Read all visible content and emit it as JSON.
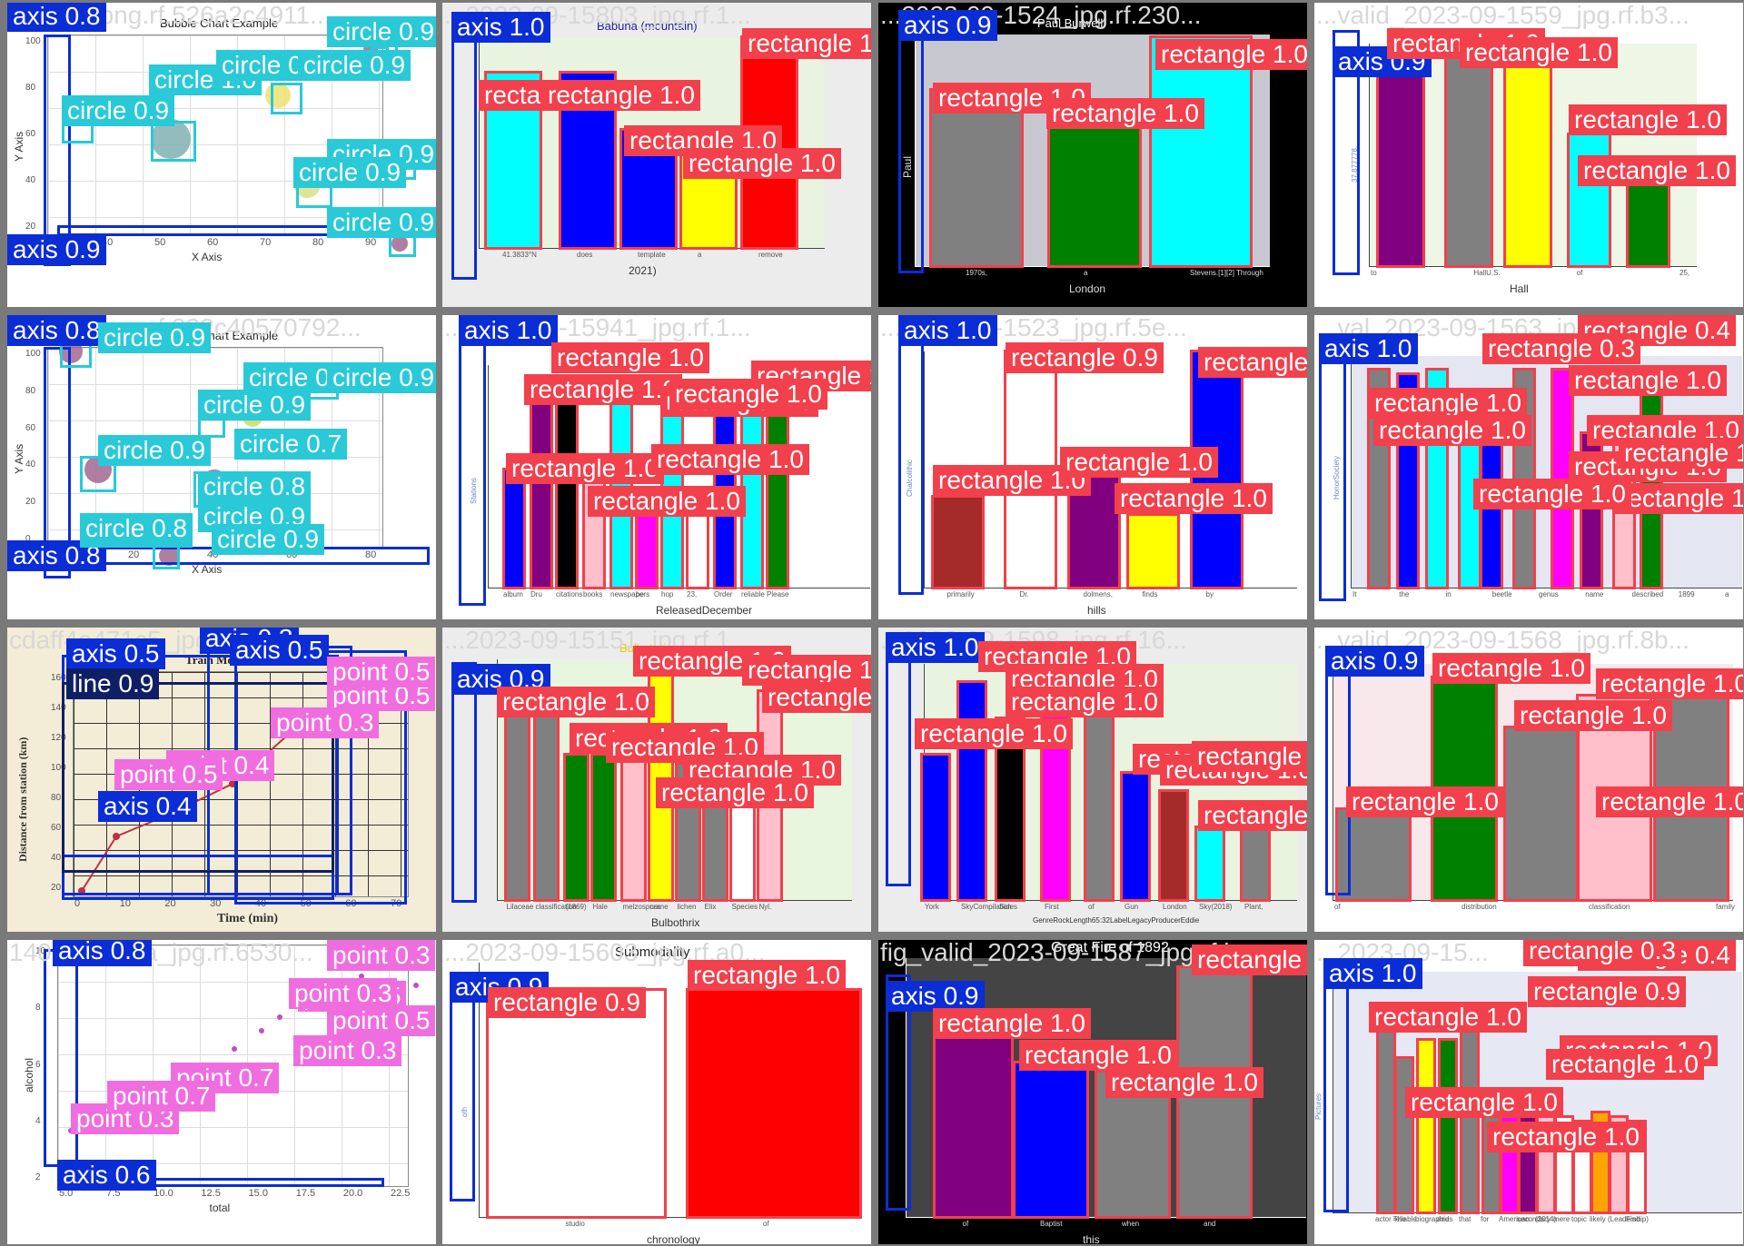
{
  "colors": {
    "axis": "#0b2dd6",
    "rectangle": "#f2404c",
    "circle": "#29c9d8",
    "point": "#f06ddf",
    "line": "#0f1f66"
  },
  "tiles": [
    {
      "filename": "bubble_png.rf.526a2c4911...",
      "title": "Bubble Chart Example",
      "xlabel": "X Axis",
      "ylabel": "Y Axis",
      "xticks": [
        "30",
        "40",
        "50",
        "60",
        "70",
        "80",
        "90"
      ],
      "yticks": [
        "100",
        "80",
        "60",
        "40",
        "20"
      ],
      "detections": [
        {
          "cls": "axis",
          "score": "0.8"
        },
        {
          "cls": "axis",
          "score": "0.9"
        },
        {
          "cls": "circle",
          "score": "0.9"
        },
        {
          "cls": "circle",
          "score": "0.9"
        },
        {
          "cls": "circle",
          "score": "1.0"
        },
        {
          "cls": "circle",
          "score": "0.9"
        },
        {
          "cls": "circle",
          "score": "0.9"
        },
        {
          "cls": "circle",
          "score": "0.9"
        },
        {
          "cls": "circle",
          "score": "0.9"
        },
        {
          "cls": "circle",
          "score": "0.9"
        }
      ]
    },
    {
      "filename": "...2023-09-15803_jpg.rf.1...",
      "title": "Babuna (mountain)",
      "xticks": [
        "41.3833°N",
        "does",
        "template",
        "a",
        "remove"
      ],
      "xlabel": "2021)",
      "detections": [
        {
          "cls": "axis",
          "score": "1.0"
        },
        {
          "cls": "rectangle",
          "score": "1.0"
        },
        {
          "cls": "rectangle",
          "score": "1.0"
        },
        {
          "cls": "rectangle",
          "score": "1.0"
        },
        {
          "cls": "rectangle",
          "score": "1.0"
        },
        {
          "cls": "rectangle",
          "score": "1.0"
        }
      ]
    },
    {
      "filename": "...2023-09-1524_jpg.rf.230...",
      "title": "Paul Burwell",
      "ylabel": "Paul",
      "xticks": [
        "1970s,",
        "a",
        "Stevens.[1][2] Through"
      ],
      "xlabel": "London",
      "detections": [
        {
          "cls": "axis",
          "score": "0.9"
        },
        {
          "cls": "rectangle",
          "score": "1.0"
        },
        {
          "cls": "rectangle",
          "score": "1.0"
        },
        {
          "cls": "rectangle",
          "score": "1.0"
        },
        {
          "cls": "rectangle",
          "score": "1.0"
        }
      ]
    },
    {
      "filename": "...valid_2023-09-1559_jpg.rf.b3...",
      "ylabel": "37.877778,",
      "xticks": [
        "to",
        "HallU.S.",
        "of",
        "25,"
      ],
      "xlabel": "Hall",
      "detections": [
        {
          "cls": "axis",
          "score": "0.9"
        },
        {
          "cls": "rectangle",
          "score": "1.0"
        },
        {
          "cls": "rectangle",
          "score": "1.0"
        },
        {
          "cls": "rectangle",
          "score": "1.0"
        },
        {
          "cls": "rectangle",
          "score": "1.0"
        },
        {
          "cls": "rectangle",
          "score": "1.0"
        }
      ]
    },
    {
      "filename": "bubble_png.rf.832c40570792...",
      "title": "Bubble Chart Example",
      "xlabel": "X Axis",
      "ylabel": "Y Axis",
      "xticks": [
        "0",
        "20",
        "40",
        "60",
        "80"
      ],
      "yticks": [
        "100",
        "80",
        "60",
        "40",
        "20",
        "0"
      ],
      "detections": [
        {
          "cls": "axis",
          "score": "0.8"
        },
        {
          "cls": "axis",
          "score": "0.8"
        },
        {
          "cls": "circle",
          "score": "0.9"
        },
        {
          "cls": "circle",
          "score": "0.7"
        },
        {
          "cls": "circle",
          "score": "0.9"
        },
        {
          "cls": "circle",
          "score": "0.9"
        },
        {
          "cls": "circle",
          "score": "0.7"
        },
        {
          "cls": "circle",
          "score": "0.8"
        },
        {
          "cls": "circle",
          "score": "0.9"
        },
        {
          "cls": "circle",
          "score": "0.9"
        },
        {
          "cls": "circle",
          "score": "1.0"
        },
        {
          "cls": "circle",
          "score": "0.9"
        },
        {
          "cls": "circle",
          "score": "0.8"
        },
        {
          "cls": "circle",
          "score": "0.9"
        }
      ]
    },
    {
      "filename": "...2023-09-15941_jpg.rf.1...",
      "ylabel": "Stations",
      "xticks": [
        "album",
        "Dru",
        "citations",
        "books",
        "newspapers",
        "be",
        "hop",
        "23,",
        "Order",
        "reliable",
        "Please"
      ],
      "xlabel": "ReleasedDecember",
      "detections": [
        {
          "cls": "axis",
          "score": "1.0"
        },
        {
          "cls": "rectangle",
          "score": "1.0"
        },
        {
          "cls": "rectangle",
          "score": "1.0"
        },
        {
          "cls": "rectangle",
          "score": "1.0"
        },
        {
          "cls": "rectangle",
          "score": "1.0"
        },
        {
          "cls": "rectangle",
          "score": "1.0"
        },
        {
          "cls": "rectangle",
          "score": "1.0"
        },
        {
          "cls": "rectangle",
          "score": "1.0"
        },
        {
          "cls": "rectangle",
          "score": "1.0"
        }
      ]
    },
    {
      "filename": "...2023-09-1523_jpg.rf.5e...",
      "ylabel": "Chalcolithic",
      "xticks": [
        "primarily",
        "Dr.",
        "dolmens,",
        "finds",
        "by"
      ],
      "xlabel": "hills",
      "detections": [
        {
          "cls": "axis",
          "score": "1.0"
        },
        {
          "cls": "rectangle",
          "score": "0.9"
        },
        {
          "cls": "rectangle",
          "score": "1.0"
        },
        {
          "cls": "rectangle",
          "score": "1.0"
        },
        {
          "cls": "rectangle",
          "score": "1.0"
        },
        {
          "cls": "rectangle",
          "score": "1.0"
        }
      ]
    },
    {
      "filename": "...val_2023-09-1563_jpg.rf.20...",
      "ylabel": "HonorSociety",
      "xticks": [
        "It",
        "the",
        "in",
        "beetle",
        "genus",
        "name",
        "described",
        "1899",
        "a"
      ],
      "detections": [
        {
          "cls": "axis",
          "score": "1.0"
        },
        {
          "cls": "rectangle",
          "score": "0.4"
        },
        {
          "cls": "rectangle",
          "score": "0.3"
        },
        {
          "cls": "rectangle",
          "score": "1.0"
        },
        {
          "cls": "rectangle",
          "score": "1.0"
        },
        {
          "cls": "rectangle",
          "score": "1.0"
        },
        {
          "cls": "rectangle",
          "score": "1.0"
        },
        {
          "cls": "rectangle",
          "score": "1.0"
        },
        {
          "cls": "rectangle",
          "score": "1.0"
        },
        {
          "cls": "rectangle",
          "score": "1.0"
        },
        {
          "cls": "rectangle",
          "score": "1.0"
        }
      ]
    },
    {
      "filename": "cdaff4e471c5_jpg.rf.bf4d...",
      "title": "Train Motion",
      "xlabel": "Time (min)",
      "ylabel": "Distance from station (km)",
      "xticks": [
        "0",
        "10",
        "20",
        "30",
        "40",
        "50",
        "60",
        "70"
      ],
      "yticks": [
        "160",
        "140",
        "120",
        "100",
        "80",
        "60",
        "40",
        "20"
      ],
      "detections": [
        {
          "cls": "axis",
          "score": "0.5"
        },
        {
          "cls": "axis",
          "score": "0.3"
        },
        {
          "cls": "axis",
          "score": "0.5"
        },
        {
          "cls": "axis",
          "score": "0.4"
        },
        {
          "cls": "line",
          "score": "0.9"
        },
        {
          "cls": "point",
          "score": "0.5"
        },
        {
          "cls": "point",
          "score": "0.3"
        },
        {
          "cls": "point",
          "score": "0.4"
        },
        {
          "cls": "point",
          "score": "0.5"
        },
        {
          "cls": "point",
          "score": "0.5"
        }
      ]
    },
    {
      "filename": "...2023-09-15151_jpg.rf.1...",
      "title": "Bulbothrix",
      "xticks": [
        "Lilaceae",
        "classification",
        "(1869)",
        "Hale",
        "melzospora",
        "name",
        "lichen",
        "Elix",
        "Species",
        "Nyl."
      ],
      "xlabel": "Bulbothrix",
      "detections": [
        {
          "cls": "axis",
          "score": "0.9"
        },
        {
          "cls": "rectangle",
          "score": "1.0"
        },
        {
          "cls": "rectangle",
          "score": "1.0"
        },
        {
          "cls": "rectangle",
          "score": "1.0"
        },
        {
          "cls": "rectangle",
          "score": "1.0"
        },
        {
          "cls": "rectangle",
          "score": "1.0"
        },
        {
          "cls": "rectangle",
          "score": "1.0"
        },
        {
          "cls": "rectangle",
          "score": "1.0"
        },
        {
          "cls": "rectangle",
          "score": "1.0"
        }
      ]
    },
    {
      "filename": "...2023-09-1598_jpg.rf.16...",
      "title": "...e Sky",
      "xticks": [
        "York",
        "SkyCompilation",
        "Sides",
        "First",
        "of",
        "Gun",
        "London",
        "Sky(2018)",
        "Plant,"
      ],
      "xlabel": "GenreRockLength65:32LabelLegacyProducerEddie",
      "detections": [
        {
          "cls": "axis",
          "score": "1.0"
        },
        {
          "cls": "rectangle",
          "score": "1.0"
        },
        {
          "cls": "rectangle",
          "score": "1.0"
        },
        {
          "cls": "rectangle",
          "score": "1.0"
        },
        {
          "cls": "rectangle",
          "score": "1.0"
        },
        {
          "cls": "rectangle",
          "score": "1.0"
        },
        {
          "cls": "rectangle",
          "score": "1.0"
        },
        {
          "cls": "rectangle",
          "score": "1.0"
        },
        {
          "cls": "rectangle",
          "score": "1.0"
        }
      ]
    },
    {
      "filename": "...valid_2023-09-1568_jpg.rf.8b...",
      "xticks": [
        "of",
        "distribution",
        "classification",
        "family"
      ],
      "detections": [
        {
          "cls": "axis",
          "score": "0.9"
        },
        {
          "cls": "rectangle",
          "score": "1.0"
        },
        {
          "cls": "rectangle",
          "score": "1.0"
        },
        {
          "cls": "rectangle",
          "score": "1.0"
        },
        {
          "cls": "rectangle",
          "score": "1.0"
        },
        {
          "cls": "rectangle",
          "score": "1.0"
        }
      ]
    },
    {
      "filename": "14016...3dda_jpg.rf.6530...",
      "xlabel": "total",
      "ylabel": "alcohol",
      "xticks": [
        "5.0",
        "7.5",
        "10.0",
        "12.5",
        "15.0",
        "17.5",
        "20.0",
        "22.5"
      ],
      "yticks": [
        "10",
        "8",
        "6",
        "4",
        "2"
      ],
      "detections": [
        {
          "cls": "axis",
          "score": "0.8"
        },
        {
          "cls": "axis",
          "score": "0.6"
        },
        {
          "cls": "point",
          "score": "0.3"
        },
        {
          "cls": "point",
          "score": "0.5"
        },
        {
          "cls": "point",
          "score": "0.5"
        },
        {
          "cls": "point",
          "score": "0.3"
        },
        {
          "cls": "point",
          "score": "0.3"
        },
        {
          "cls": "point",
          "score": "0.7"
        },
        {
          "cls": "point",
          "score": "0.3"
        },
        {
          "cls": "point",
          "score": "0.7"
        }
      ]
    },
    {
      "filename": "...2023-09-15603_jpg.rf.a0...",
      "title": "Submodality",
      "ylabel": "oth",
      "xticks": [
        "studio",
        "of"
      ],
      "xlabel": "chronology",
      "detections": [
        {
          "cls": "axis",
          "score": "0.9"
        },
        {
          "cls": "rectangle",
          "score": "0.9"
        },
        {
          "cls": "rectangle",
          "score": "1.0"
        }
      ]
    },
    {
      "filename": "fig_valid_2023-09-1587_jpg.rf.b...",
      "title": "Great Fire of 1892",
      "xticks": [
        "of",
        "Baptist",
        "when",
        "and"
      ],
      "xlabel": "this",
      "detections": [
        {
          "cls": "axis",
          "score": "0.9"
        },
        {
          "cls": "rectangle",
          "score": "1.0"
        },
        {
          "cls": "rectangle",
          "score": "1.0"
        },
        {
          "cls": "rectangle",
          "score": "1.0"
        },
        {
          "cls": "rectangle",
          "score": "1.0"
        }
      ]
    },
    {
      "filename": "...2023-09-15...",
      "ylabel": "Pictures",
      "xticks": [
        "actor The",
        "reliable",
        "biographies",
        "and",
        "that",
        "for",
        "American",
        "secondary",
        "(2014)",
        "mere",
        "topic",
        "likely",
        "(Leadership)",
        "Find"
      ],
      "detections": [
        {
          "cls": "axis",
          "score": "1.0"
        },
        {
          "cls": "rectangle",
          "score": "0.4"
        },
        {
          "cls": "rectangle",
          "score": "0.3"
        },
        {
          "cls": "rectangle",
          "score": "0.9"
        },
        {
          "cls": "rectangle",
          "score": "1.0"
        },
        {
          "cls": "rectangle",
          "score": "1.0"
        },
        {
          "cls": "rectangle",
          "score": "1.0"
        },
        {
          "cls": "rectangle",
          "score": "1.0"
        },
        {
          "cls": "rectangle",
          "score": "1.0"
        }
      ]
    }
  ]
}
